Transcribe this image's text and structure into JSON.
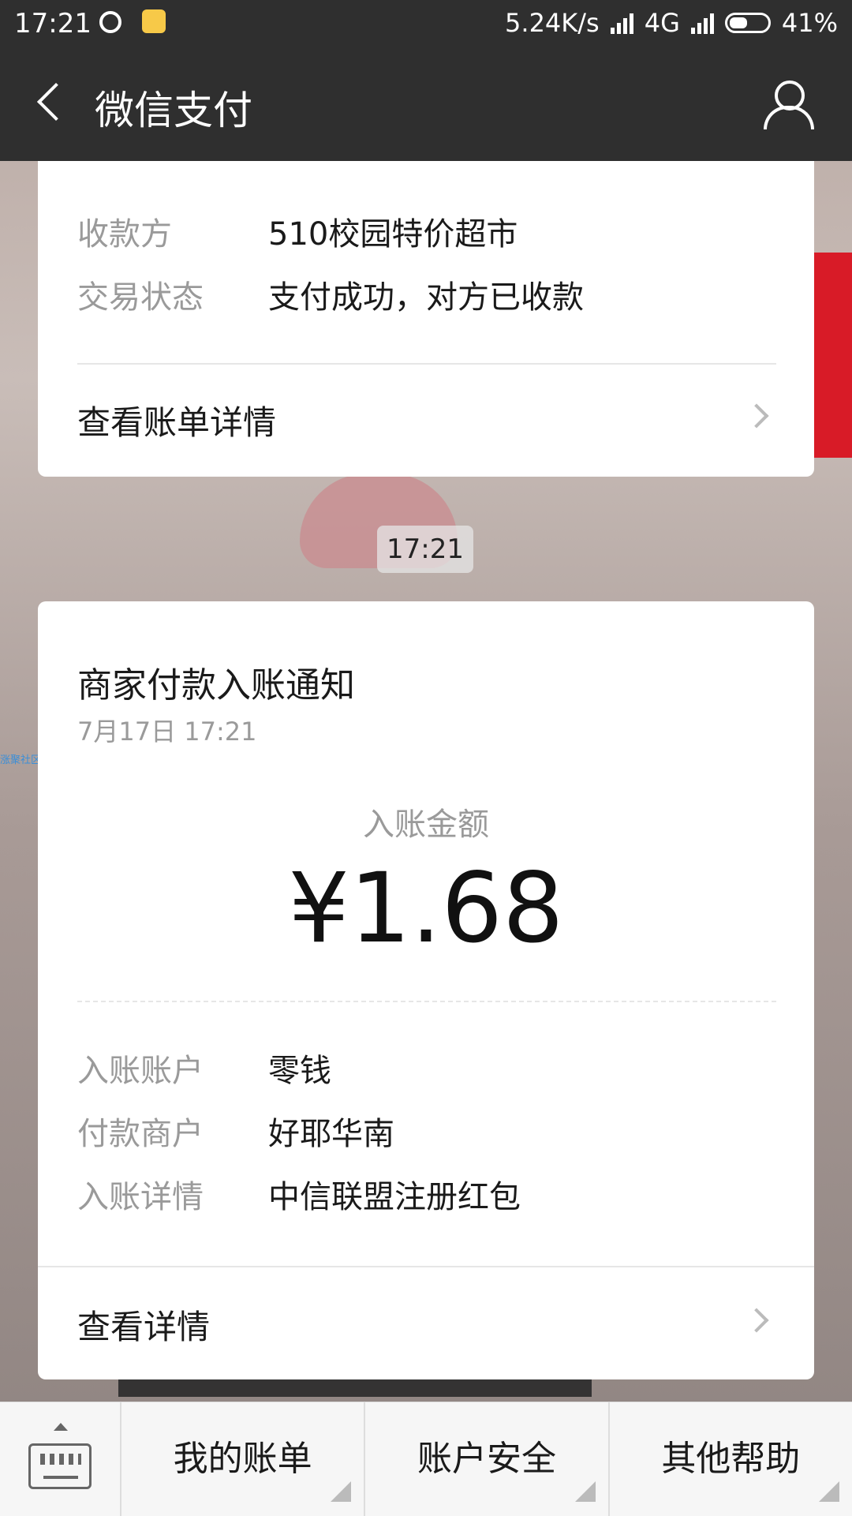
{
  "status_bar": {
    "time": "17:21",
    "network_speed": "5.24K/s",
    "network_type": "4G",
    "battery": "41%"
  },
  "nav": {
    "title": "微信支付"
  },
  "payment_card": {
    "rows": [
      {
        "label": "收款方",
        "value": "510校园特价超市"
      },
      {
        "label": "交易状态",
        "value": "支付成功，对方已收款"
      }
    ],
    "link": "查看账单详情"
  },
  "timestamp": "17:21",
  "notice_card": {
    "title": "商家付款入账通知",
    "date": "7月17日  17:21",
    "amount_label": "入账金额",
    "amount": "¥1.68",
    "rows": [
      {
        "label": "入账账户",
        "value": "零钱"
      },
      {
        "label": "付款商户",
        "value": "好耶华南"
      },
      {
        "label": "入账详情",
        "value": "中信联盟注册红包"
      }
    ],
    "link": "查看详情"
  },
  "watermark": "涨聚社区",
  "bottom_menu": {
    "items": [
      "我的账单",
      "账户安全",
      "其他帮助"
    ]
  },
  "colors": {
    "nav_bg": "#2f2f2f",
    "card_bg": "#ffffff",
    "label_gray": "#9a9a9a"
  }
}
